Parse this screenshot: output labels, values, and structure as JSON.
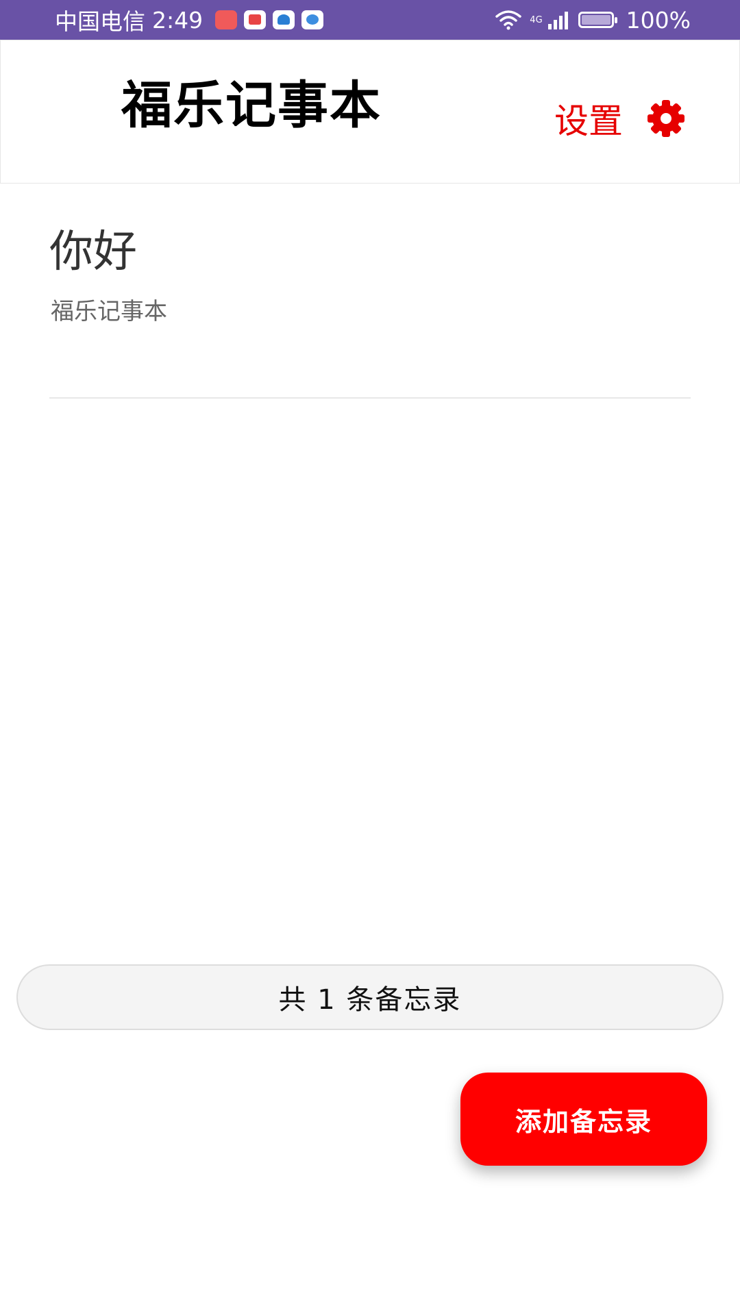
{
  "status_bar": {
    "carrier": "中国电信",
    "time": "2:49",
    "network": "4G",
    "battery": "100%"
  },
  "header": {
    "title": "福乐记事本",
    "settings_label": "设置"
  },
  "notes": [
    {
      "title": "你好",
      "subtitle": "福乐记事本"
    }
  ],
  "footer": {
    "count_text": "共 1 条备忘录",
    "add_button_label": "添加备忘录"
  },
  "colors": {
    "status_bar_bg": "#6952a6",
    "accent_red": "#ff0000",
    "settings_red": "#e60000"
  },
  "icons": {
    "settings": "gear-icon",
    "wifi": "wifi-icon",
    "signal": "signal-icon",
    "battery": "battery-icon"
  }
}
